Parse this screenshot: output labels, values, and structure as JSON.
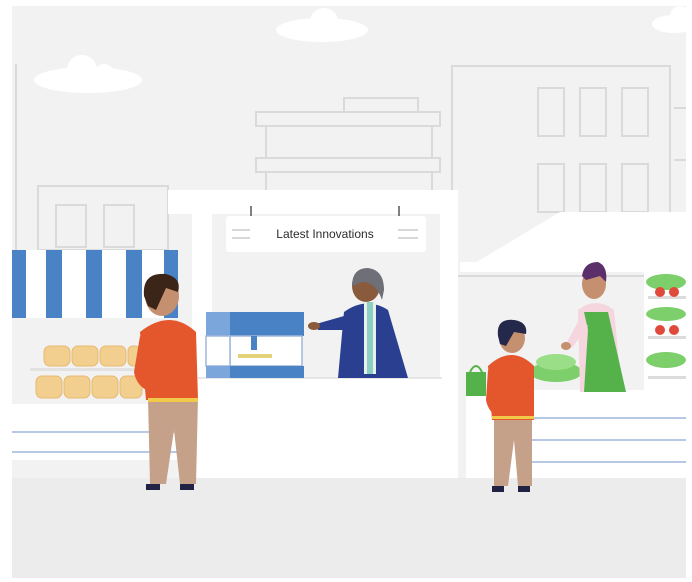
{
  "scene": {
    "sign": {
      "label": "Latest Innovations"
    },
    "colors": {
      "background": "#f2f2f2",
      "building_outline": "#dadada",
      "accent_blue": "#4a82c6",
      "shirt_orange": "#e4562b",
      "pants_tan": "#c6a18a",
      "apron_green": "#55b24b",
      "jacket_navy": "#2a3f8f",
      "bread": "#f2cf8f",
      "tomato": "#e04a3a"
    },
    "icons": [
      "cloud-icon",
      "awning-icon",
      "3d-printer-icon",
      "bread-icon",
      "vegetable-crate-icon",
      "shopping-bag-icon"
    ]
  }
}
